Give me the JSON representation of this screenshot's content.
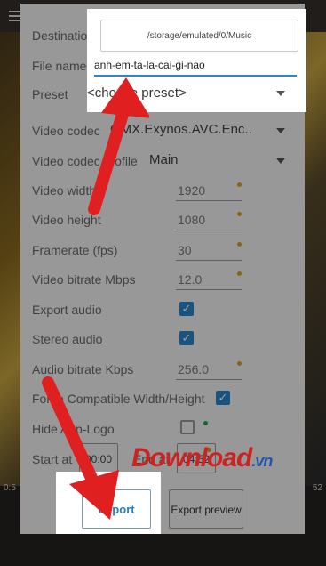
{
  "labels": {
    "destination": "Destination",
    "file_name": "File name",
    "preset": "Preset",
    "video_codec": "Video codec",
    "video_codec_profile": "Video codec profile",
    "video_width": "Video width",
    "video_height": "Video height",
    "framerate": "Framerate (fps)",
    "video_bitrate": "Video bitrate Mbps",
    "export_audio": "Export audio",
    "stereo_audio": "Stereo audio",
    "audio_bitrate": "Audio bitrate Kbps",
    "force_compatible": "Force Compatible Width/Height",
    "hide_logo": "Hide App-Logo",
    "start_at": "Start at",
    "end_at": "End at"
  },
  "values": {
    "destination": "/storage/emulated/0/Music",
    "file_name": "anh-em-ta-la-cai-gi-nao",
    "preset": "<choose preset>",
    "video_codec": "OMX.Exynos.AVC.Enc..",
    "video_codec_profile": "Main",
    "video_width": "1920",
    "video_height": "1080",
    "framerate": "30",
    "video_bitrate": "12.0",
    "audio_bitrate": "256.0",
    "start_at": "00:00",
    "end_at": "04:52"
  },
  "checkboxes": {
    "export_audio": true,
    "stereo_audio": true,
    "force_compatible": true,
    "hide_logo": false
  },
  "buttons": {
    "export": "Export",
    "export_preview": "Export preview"
  },
  "player": {
    "time_left": "0:5",
    "time_right": "52"
  },
  "watermark": {
    "main": "Download",
    "suffix": ".vn"
  },
  "colors": {
    "accent": "#2a88cc",
    "dot": "#e0a020",
    "arrow": "#e02020"
  }
}
